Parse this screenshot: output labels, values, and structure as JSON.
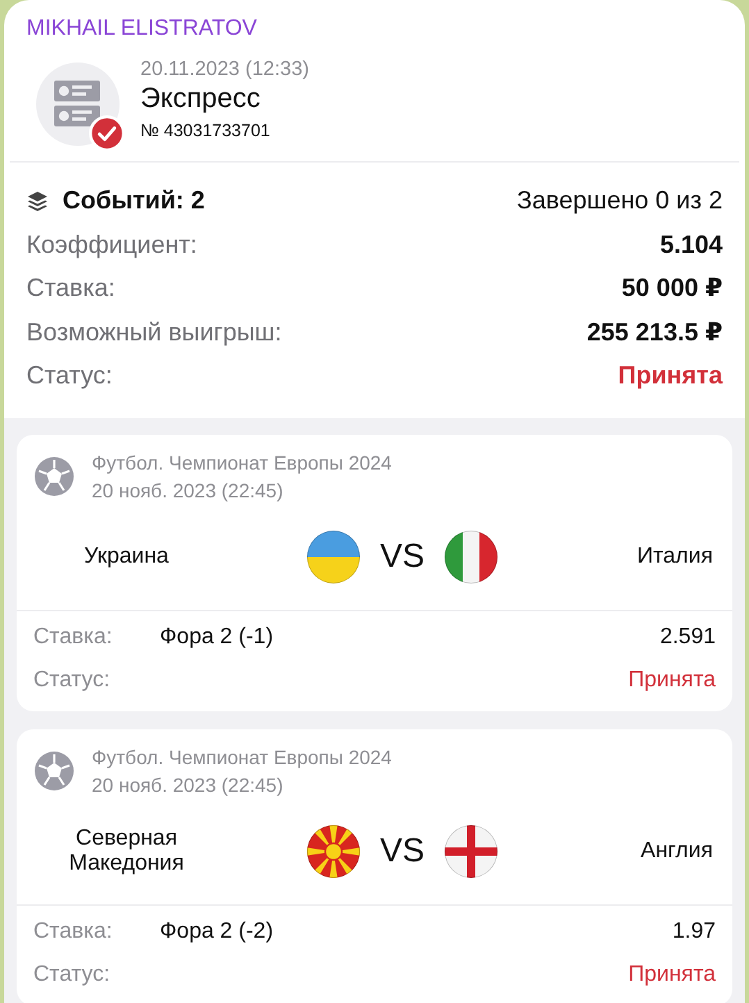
{
  "sender": "MIKHAIL ELISTRATOV",
  "bet": {
    "date": "20.11.2023 (12:33)",
    "type": "Экспресс",
    "number": "№ 43031733701",
    "confirmed": true
  },
  "summary": {
    "events_label": "Событий: 2",
    "events_value": "Завершено 0 из 2",
    "rows": [
      {
        "label": "Коэффициент:",
        "value": "5.104",
        "kind": "plain"
      },
      {
        "label": "Ставка:",
        "value": "50 000 ₽",
        "kind": "plain"
      },
      {
        "label": "Возможный выигрыш:",
        "value": "255 213.5 ₽",
        "kind": "plain"
      },
      {
        "label": "Статус:",
        "value": "Принята",
        "kind": "status"
      }
    ]
  },
  "matches": [
    {
      "league": "Футбол. Чемпионат Европы 2024",
      "date": "20 нояб. 2023 (22:45)",
      "home": {
        "name": "Украина",
        "kind": "ukraine"
      },
      "vs": "VS",
      "away": {
        "name": "Италия",
        "kind": "italy"
      },
      "bet_label": "Ставка:",
      "bet": "Фора 2 (-1)",
      "odds": "2.591",
      "status_label": "Статус:",
      "status": "Принята"
    },
    {
      "league": "Футбол. Чемпионат Европы 2024",
      "date": "20 нояб. 2023 (22:45)",
      "home": {
        "name": "Северная Македония",
        "kind": "macedonia"
      },
      "vs": "VS",
      "away": {
        "name": "Англия",
        "kind": "england"
      },
      "bet_label": "Ставка:",
      "bet": "Фора 2 (-2)",
      "odds": "1.97",
      "status_label": "Статус:",
      "status": "Принята"
    }
  ]
}
